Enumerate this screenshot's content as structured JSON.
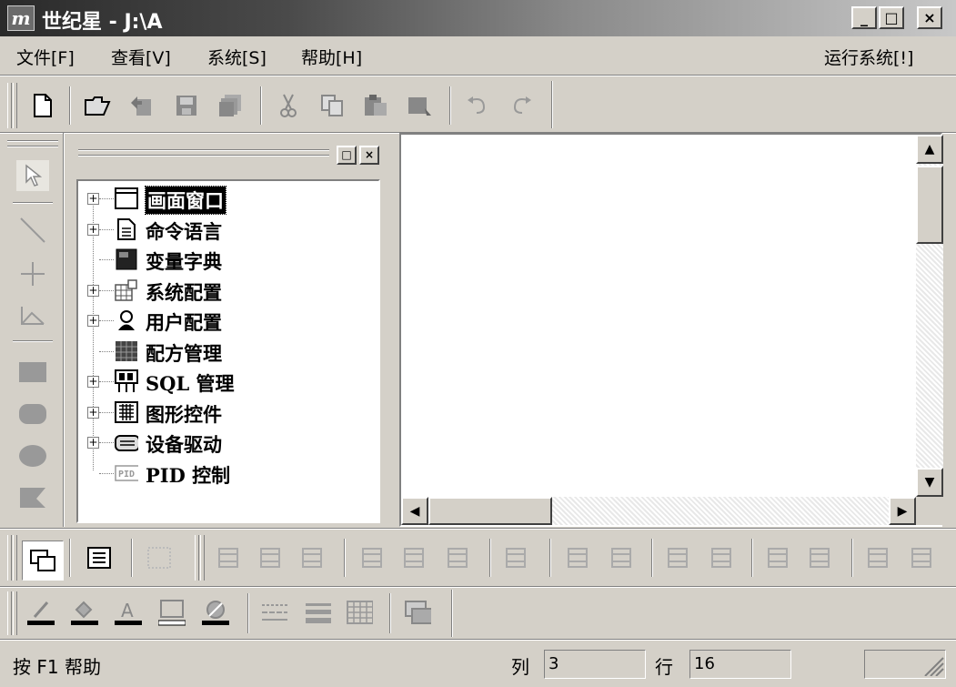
{
  "window": {
    "app_icon_text": "m",
    "title": "世纪星 - J:\\A",
    "min_label": "_",
    "max_label": "□",
    "close_label": "×"
  },
  "menu": {
    "items": [
      "文件[F]",
      "查看[V]",
      "系统[S]",
      "帮助[H]"
    ],
    "run_system": "运行系统[!]"
  },
  "toolbar_main": {
    "icons": [
      "new-document-icon",
      "open-folder-icon",
      "import-icon",
      "save-icon",
      "save-all-icon",
      "cut-icon",
      "copy-icon",
      "paste-icon",
      "delete-icon",
      "undo-icon",
      "redo-icon"
    ]
  },
  "tree": {
    "items": [
      {
        "label": "画面窗口",
        "icon": "window-icon",
        "expandable": true,
        "selected": true
      },
      {
        "label": "命令语言",
        "icon": "document-icon",
        "expandable": true,
        "selected": false
      },
      {
        "label": "变量字典",
        "icon": "dictionary-icon",
        "expandable": false,
        "selected": false
      },
      {
        "label": "系统配置",
        "icon": "system-config-icon",
        "expandable": true,
        "selected": false
      },
      {
        "label": "用户配置",
        "icon": "user-icon",
        "expandable": true,
        "selected": false
      },
      {
        "label": "配方管理",
        "icon": "recipe-icon",
        "expandable": false,
        "selected": false
      },
      {
        "label": "SQL 管理",
        "icon": "sql-icon",
        "expandable": true,
        "selected": false
      },
      {
        "label": "图形控件",
        "icon": "graphic-control-icon",
        "expandable": true,
        "selected": false
      },
      {
        "label": "设备驱动",
        "icon": "device-driver-icon",
        "expandable": true,
        "selected": false
      },
      {
        "label": "PID 控制",
        "icon": "pid-icon",
        "expandable": false,
        "selected": false
      }
    ]
  },
  "status": {
    "help": "按 F1 帮助",
    "col_label": "列",
    "col_value": "3",
    "row_label": "行",
    "row_value": "16"
  }
}
